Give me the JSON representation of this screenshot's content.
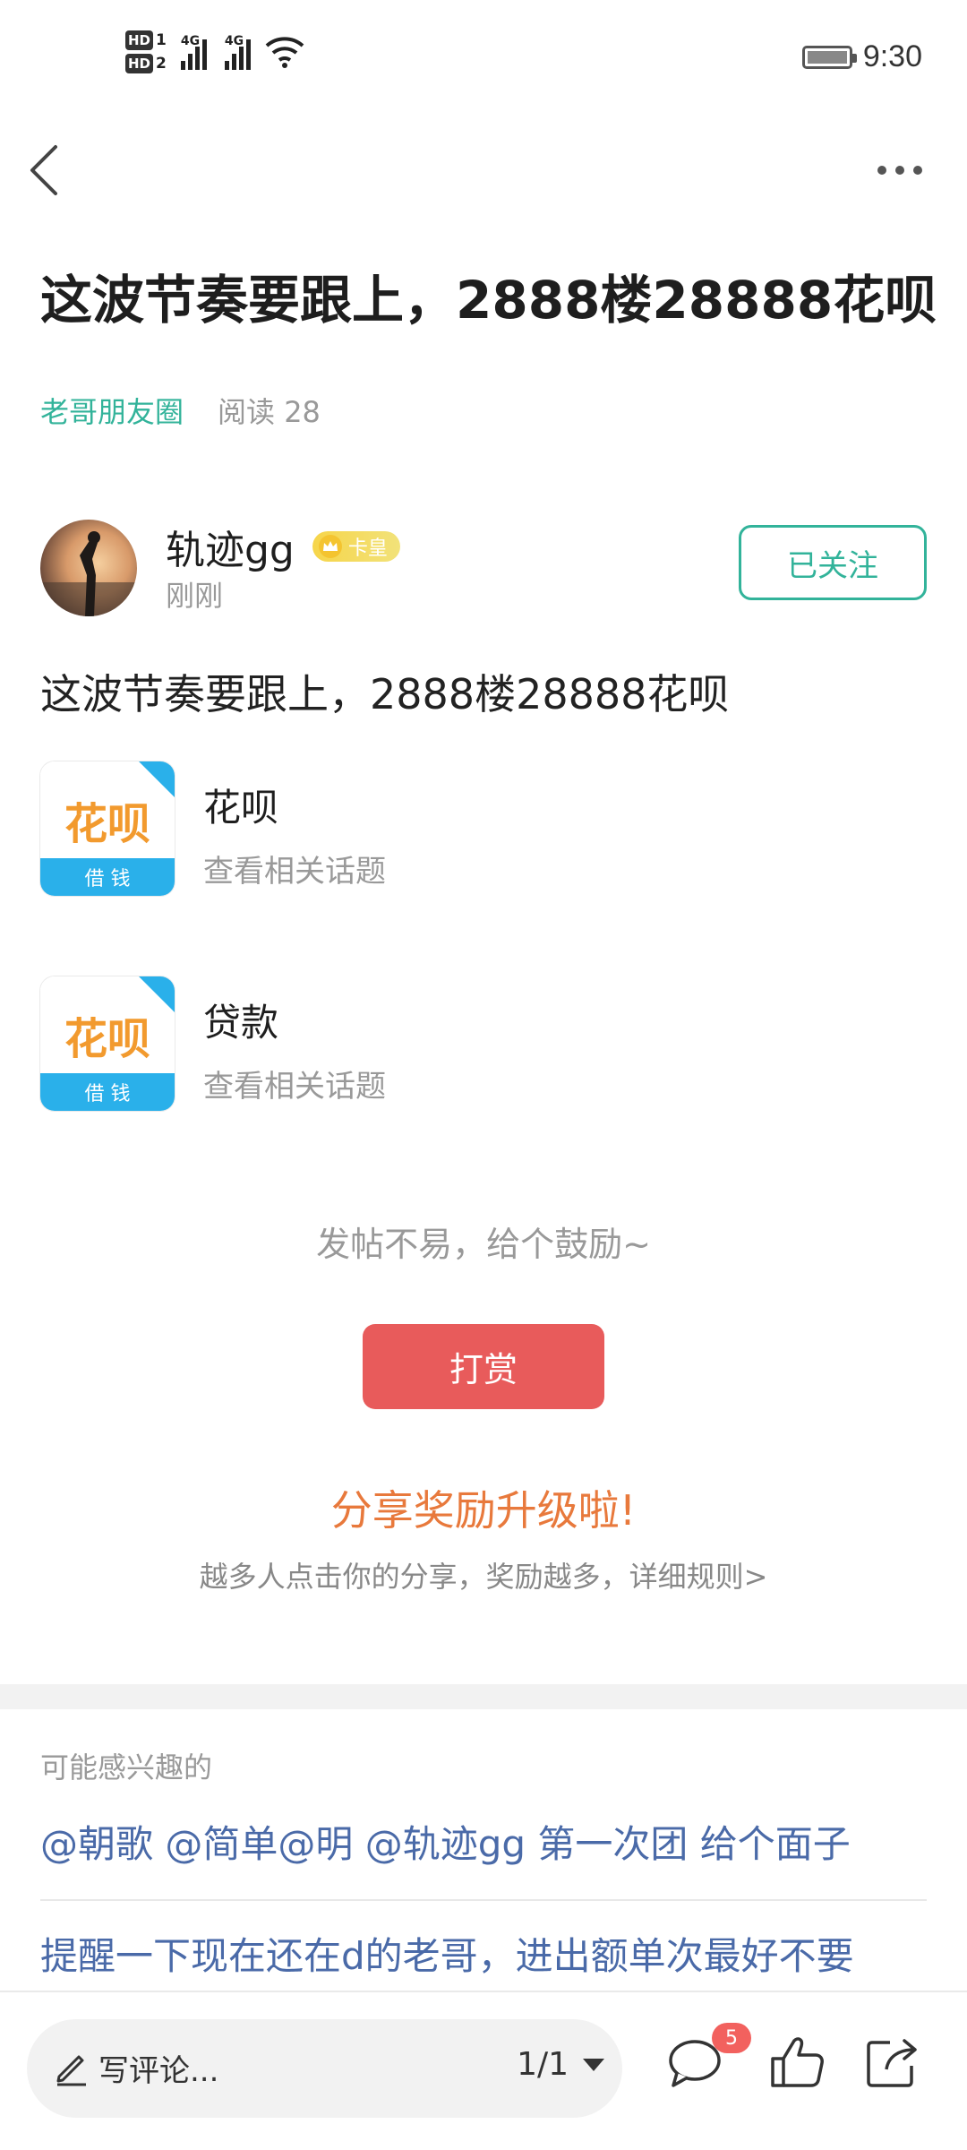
{
  "status_bar": {
    "hd1": "HD",
    "hd1_sub": "1",
    "hd2": "HD",
    "hd2_sub": "2",
    "net1": "4G",
    "net2": "4G",
    "time": "9:30"
  },
  "nav": {
    "back_icon": "chevron-left-icon",
    "more_icon": "more-horizontal-icon"
  },
  "post": {
    "title": "这波节奏要跟上，2888楼28888花呗",
    "circle": "老哥朋友圈",
    "read_count": "阅读 28",
    "author": {
      "name": "轨迹gg",
      "badge": "卡皇",
      "time": "刚刚",
      "follow_label": "已关注"
    },
    "body": "这波节奏要跟上，2888楼28888花呗",
    "topics": [
      {
        "name": "花呗",
        "sub": "查看相关话题",
        "icon_text": "花呗",
        "icon_sub": "借 钱"
      },
      {
        "name": "贷款",
        "sub": "查看相关话题",
        "icon_text": "花呗",
        "icon_sub": "借 钱"
      }
    ]
  },
  "reward": {
    "prompt": "发帖不易，给个鼓励~",
    "button": "打赏"
  },
  "share": {
    "title": "分享奖励升级啦!",
    "desc": "越多人点击你的分享，奖励越多，详细规则>"
  },
  "recommend": {
    "header": "可能感兴趣的",
    "items": [
      "@朝歌 @简单@明 @轨迹gg 第一次团 给个面子",
      "提醒一下现在还在d的老哥，进出额单次最好不要"
    ]
  },
  "bottom_bar": {
    "comment_placeholder": "写评论...",
    "page": "1/1",
    "comment_count": "5",
    "colors": {
      "accent": "#32b39a",
      "reward": "#e85b5b",
      "share": "#e8793c",
      "badge": "#f2615e"
    }
  }
}
